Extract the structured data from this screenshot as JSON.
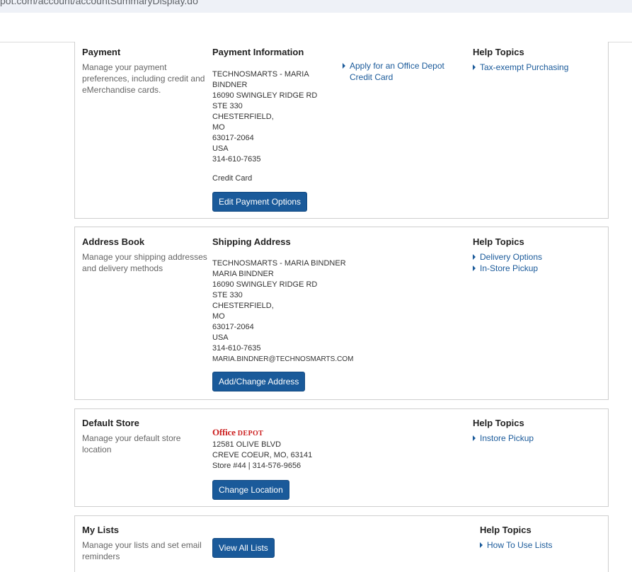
{
  "browser": {
    "url": "pot.com/account/accountSummaryDisplay.do"
  },
  "payment": {
    "title": "Payment",
    "description": "Manage your payment preferences, including credit and eMerchandise cards.",
    "info_title": "Payment Information",
    "address_lines": [
      "TECHNOSMARTS - MARIA",
      "BINDNER",
      "16090 SWINGLEY RIDGE RD",
      "STE 330",
      "CHESTERFIELD,",
      "MO",
      "63017-2064",
      "USA",
      "314-610-7635"
    ],
    "method": "Credit Card",
    "edit_button": "Edit Payment Options",
    "apply_link": "Apply for an Office Depot Credit Card",
    "help_title": "Help Topics",
    "help_links": [
      "Tax-exempt Purchasing"
    ]
  },
  "address_book": {
    "title": "Address Book",
    "description": "Manage your shipping addresses and delivery methods",
    "shipping_title": "Shipping Address",
    "address_lines": [
      "TECHNOSMARTS - MARIA BINDNER",
      "MARIA BINDNER",
      "16090 SWINGLEY RIDGE RD",
      "STE 330",
      "CHESTERFIELD,",
      "MO",
      "63017-2064",
      "USA",
      "314-610-7635"
    ],
    "email": "MARIA.BINDNER@TECHNOSMARTS.COM",
    "button": "Add/Change Address",
    "help_title": "Help Topics",
    "help_links": [
      "Delivery Options",
      "In-Store Pickup"
    ]
  },
  "default_store": {
    "title": "Default Store",
    "description": "Manage your default store location",
    "logo_text_1": "Office",
    "logo_text_2": "DEPOT",
    "address_lines": [
      "12581 OLIVE BLVD",
      "CREVE COEUR, MO, 63141",
      "Store #44 | 314-576-9656"
    ],
    "button": "Change Location",
    "help_title": "Help Topics",
    "help_links": [
      "Instore Pickup"
    ]
  },
  "my_lists": {
    "title": "My Lists",
    "description": "Manage your lists and set email reminders",
    "button": "View All Lists",
    "help_title": "Help Topics",
    "help_links": [
      "How To Use Lists"
    ]
  },
  "colors": {
    "button_blue": "#1a5a9a",
    "link_blue": "#1a5a9a",
    "logo_red": "#cc1f1f"
  }
}
